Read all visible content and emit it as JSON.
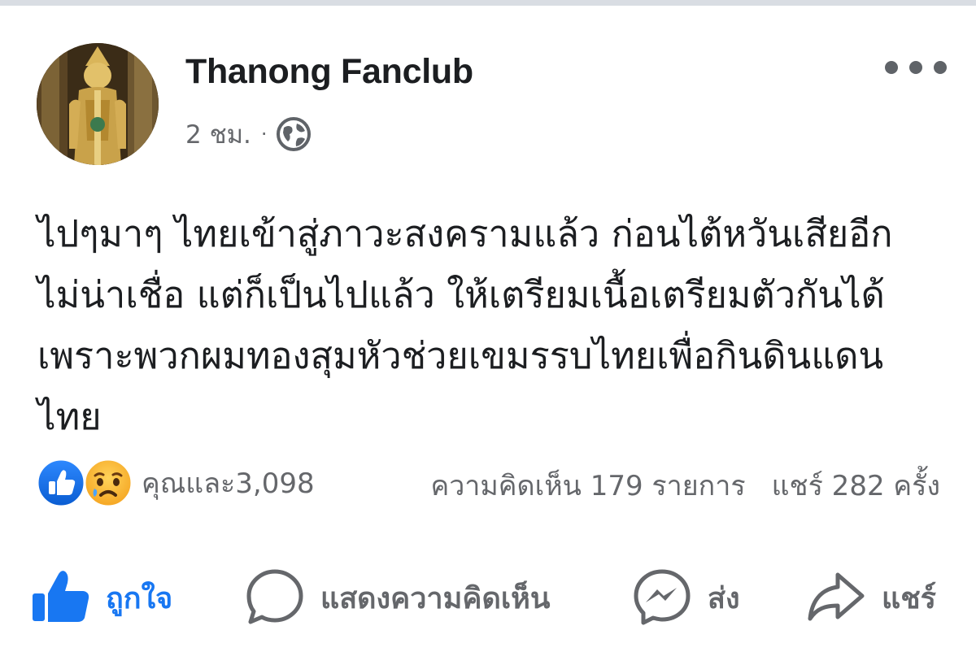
{
  "post": {
    "author": "Thanong Fanclub",
    "time": "2 ชม.",
    "separator": "·",
    "privacy_icon": "globe-icon",
    "more_icon": "more-options-icon",
    "text_lines": [
      "ไปๆมาๆ ไทยเข้าสู่ภาวะสงครามแล้ว ก่อนไต้หวันเสียอีก",
      "ไม่น่าเชื่อ แต่ก็เป็นไปแล้ว ให้เตรียมเนื้อเตรียมตัวกันได้",
      "เพราะพวกผมทองสุมหัวช่วยเขมรรบไทยเพื่อกินดินแดน",
      "ไทย"
    ]
  },
  "reactions": {
    "icons": [
      "like-reaction-icon",
      "sad-reaction-icon"
    ],
    "summary": "คุณและ3,098"
  },
  "counts": {
    "comments": "ความคิดเห็น 179 รายการ",
    "shares": "แชร์ 282 ครั้ง"
  },
  "actions": {
    "like": "ถูกใจ",
    "comment": "แสดงความคิดเห็น",
    "send": "ส่ง",
    "share": "แชร์"
  },
  "colors": {
    "accent": "#1877f2",
    "text": "#1c1e21",
    "secondary": "#65676b",
    "sad_face": "#f7b125"
  }
}
